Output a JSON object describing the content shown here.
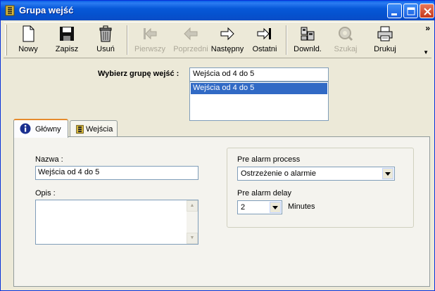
{
  "window": {
    "title": "Grupa wejść"
  },
  "toolbar": {
    "items": [
      {
        "label": "Nowy",
        "icon": "new-document-icon",
        "enabled": true
      },
      {
        "label": "Zapisz",
        "icon": "floppy-disk-icon",
        "enabled": true
      },
      {
        "label": "Usuń",
        "icon": "trash-bin-icon",
        "enabled": true
      },
      {
        "label": "Pierwszy",
        "icon": "first-arrow-icon",
        "enabled": false
      },
      {
        "label": "Poprzedni",
        "icon": "previous-arrow-icon",
        "enabled": false
      },
      {
        "label": "Następny",
        "icon": "next-arrow-icon",
        "enabled": true
      },
      {
        "label": "Ostatni",
        "icon": "last-arrow-icon",
        "enabled": true
      },
      {
        "label": "Downld.",
        "icon": "download-device-icon",
        "enabled": true
      },
      {
        "label": "Szukaj",
        "icon": "search-icon",
        "enabled": false
      },
      {
        "label": "Drukuj",
        "icon": "printer-icon",
        "enabled": true
      }
    ],
    "overflow": "»"
  },
  "group": {
    "label": "Wybierz grupę wejść :",
    "value": "Wejścia od 4 do 5",
    "options": [
      "Wejścia od 4 do 5"
    ]
  },
  "tabs": [
    {
      "label": "Główny",
      "icon": "info-icon",
      "active": true
    },
    {
      "label": "Wejścia",
      "icon": "input-module-icon",
      "active": false
    }
  ],
  "main": {
    "name_label": "Nazwa :",
    "name_value": "Wejścia od 4 do 5",
    "desc_label": "Opis :",
    "desc_value": "",
    "pre_alarm_process_label": "Pre alarm process",
    "pre_alarm_process_value": "Ostrzeżenie o alarmie",
    "pre_alarm_delay_label": "Pre alarm delay",
    "pre_alarm_delay_value": "2",
    "minutes_label": "Minutes"
  },
  "colors": {
    "titlebar": "#0a5fe8",
    "selection": "#316ac5",
    "tab_accent": "#e68b2c",
    "face": "#ece9d8"
  }
}
